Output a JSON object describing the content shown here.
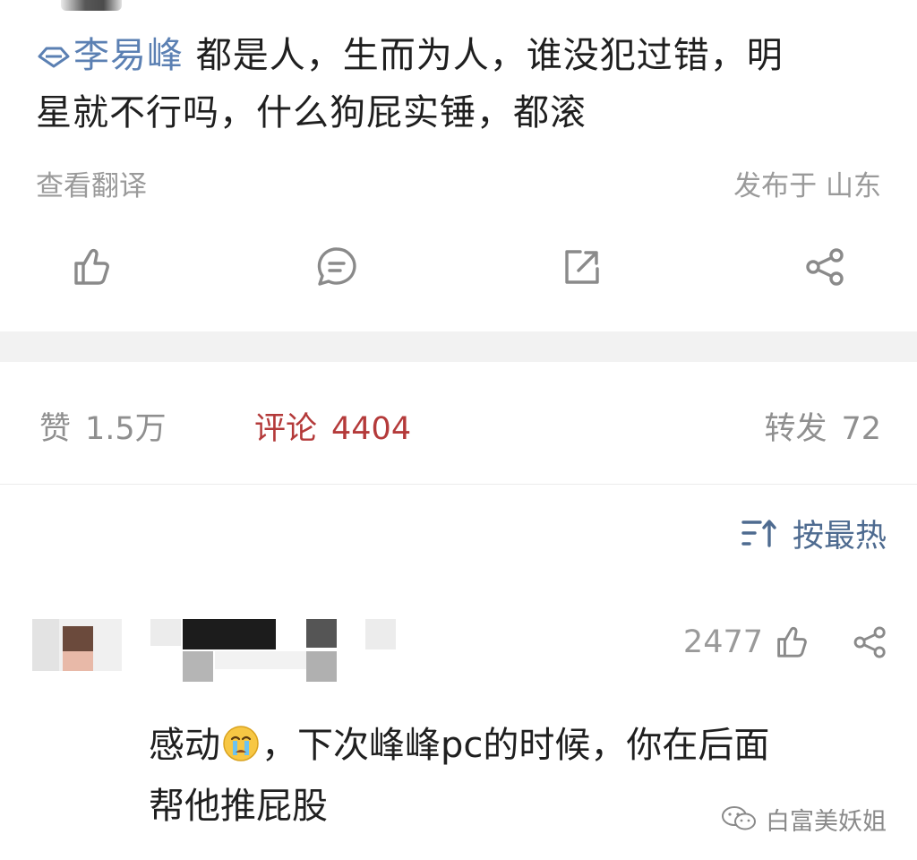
{
  "post": {
    "author": "李易峰",
    "text_line1": "都是人，生而为人，谁没犯过错，明",
    "text_line2": "星就不行吗，什么狗屁实锤，都滚",
    "translate_label": "查看翻译",
    "location": "发布于 山东"
  },
  "actions": [
    {
      "icon": "thumbs-up-icon"
    },
    {
      "icon": "comment-icon"
    },
    {
      "icon": "repost-icon"
    },
    {
      "icon": "share-icon"
    }
  ],
  "stats": {
    "likes_label": "赞",
    "likes_value": "1.5万",
    "comments_label": "评论",
    "comments_value": "4404",
    "reposts_label": "转发",
    "reposts_value": "72"
  },
  "sort": {
    "label": "按最热",
    "icon": "sort-icon"
  },
  "comment": {
    "likes": "2477",
    "text_part1": "感动",
    "emoji": "crying-face-emoji",
    "text_part2": "，下次峰峰pc的时候，你在后面",
    "text_line2": "帮他推屁股"
  },
  "watermark": {
    "text": "白富美妖姐",
    "icon": "wechat-icon"
  },
  "colors": {
    "author": "#5b80b3",
    "comments_active": "#b43a3a",
    "sort": "#4e6b90",
    "muted": "#9a9a9a"
  }
}
